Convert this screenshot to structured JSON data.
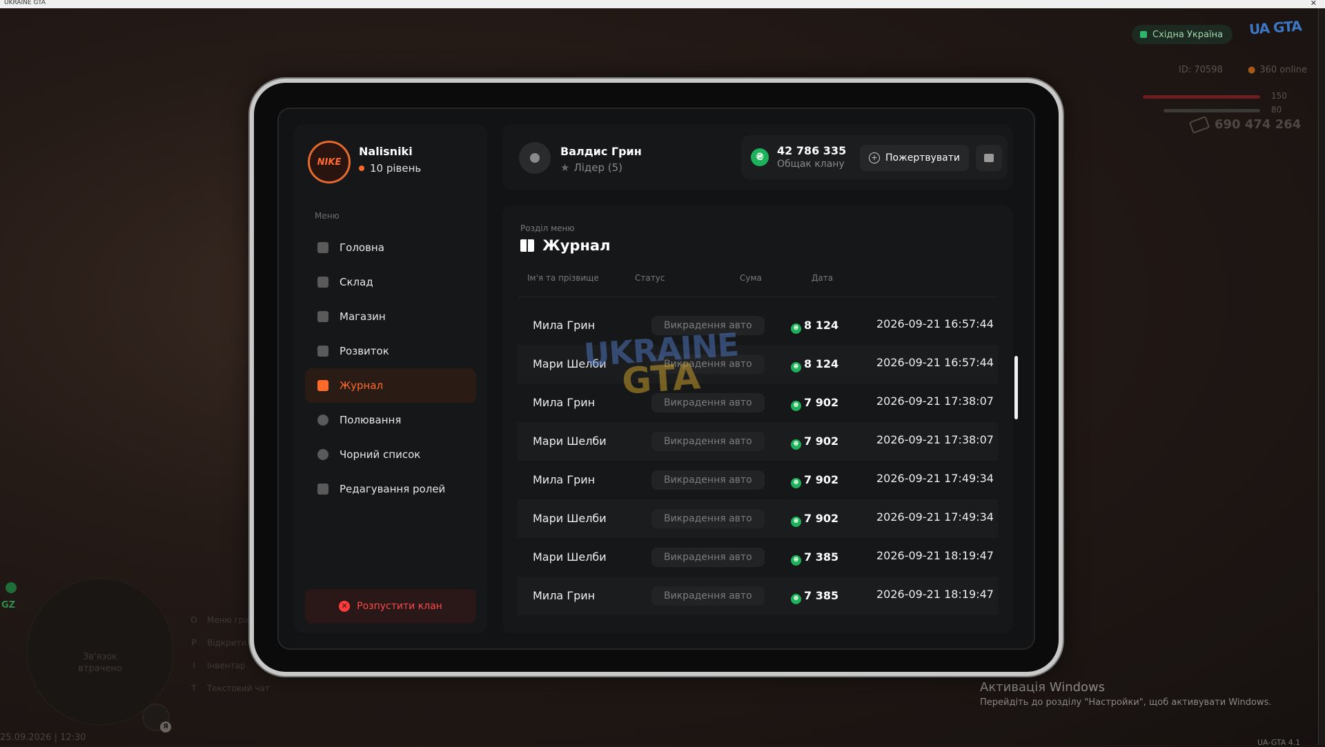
{
  "window": {
    "title": "UKRAINE GTA",
    "close": "✕"
  },
  "hud": {
    "region": "Східна Україна",
    "logo_text": "UKRAINE GTA",
    "player_id": "ID: 70598",
    "online": "360 online",
    "health": "150",
    "armor": "80",
    "money": "690 474 264",
    "minimap_status": "Зв'язок втрачено",
    "gz_label": "GZ",
    "mic_key": "Я",
    "hints": [
      {
        "key": "O",
        "label": "Меню гравця"
      },
      {
        "key": "P",
        "label": "Відкрити телефон"
      },
      {
        "key": "I",
        "label": "Інвентар"
      },
      {
        "key": "T",
        "label": "Текстовий чат"
      }
    ],
    "datetime": "25.09.2026 | 12:30",
    "version": "UA-GTA 4.1",
    "windows_activation": {
      "title": "Активація Windows",
      "subtitle": "Перейдіть до розділу \"Настройки\", щоб активувати Windows."
    }
  },
  "clan": {
    "user": {
      "name": "Nalisniki",
      "level": "10 рівень",
      "avatar_text": "NIKE"
    },
    "menu_label": "Меню",
    "menu": [
      {
        "label": "Головна",
        "icon": "home-icon",
        "active": false
      },
      {
        "label": "Склад",
        "icon": "warehouse-icon",
        "active": false
      },
      {
        "label": "Магазин",
        "icon": "shop-icon",
        "active": false
      },
      {
        "label": "Розвиток",
        "icon": "chart-icon",
        "active": false
      },
      {
        "label": "Журнал",
        "icon": "journal-icon",
        "active": true
      },
      {
        "label": "Полювання",
        "icon": "hunt-icon",
        "active": false
      },
      {
        "label": "Чорний список",
        "icon": "block-icon",
        "active": false
      },
      {
        "label": "Редагування ролей",
        "icon": "roles-icon",
        "active": false
      }
    ],
    "disband_label": "Розпустити клан",
    "header": {
      "leader_name": "Валдис Грин",
      "leader_role": "Лідер (5)",
      "balance": "42 786 335",
      "balance_label": "Общак клану",
      "donate_label": "Пожертвувати",
      "currency_symbol": "₴"
    },
    "section": {
      "label": "Розділ меню",
      "title": "Журнал",
      "columns": [
        "Ім'я та прізвище",
        "Статус",
        "Сума",
        "Дата"
      ],
      "rows": [
        {
          "name": "Мила Грин",
          "status": "Викрадення авто",
          "sum": "8 124",
          "date": "2026-09-21 16:57:44"
        },
        {
          "name": "Мари Шелби",
          "status": "Викрадення авто",
          "sum": "8 124",
          "date": "2026-09-21 16:57:44"
        },
        {
          "name": "Мила Грин",
          "status": "Викрадення авто",
          "sum": "7 902",
          "date": "2026-09-21 17:38:07"
        },
        {
          "name": "Мари Шелби",
          "status": "Викрадення авто",
          "sum": "7 902",
          "date": "2026-09-21 17:38:07"
        },
        {
          "name": "Мила Грин",
          "status": "Викрадення авто",
          "sum": "7 902",
          "date": "2026-09-21 17:49:34"
        },
        {
          "name": "Мари Шелби",
          "status": "Викрадення авто",
          "sum": "7 902",
          "date": "2026-09-21 17:49:34"
        },
        {
          "name": "Мари Шелби",
          "status": "Викрадення авто",
          "sum": "7 385",
          "date": "2026-09-21 18:19:47"
        },
        {
          "name": "Мила Грин",
          "status": "Викрадення авто",
          "sum": "7 385",
          "date": "2026-09-21 18:19:47"
        }
      ]
    },
    "watermark": {
      "line1": "UKRAINE",
      "line2": "GTA"
    }
  },
  "colors": {
    "accent": "#ff6b2b",
    "money_green": "#1db15c",
    "danger": "#ff3b3b"
  }
}
